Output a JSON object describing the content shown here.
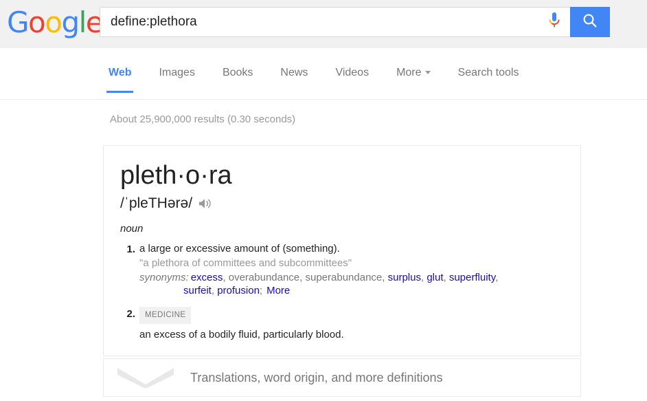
{
  "header": {
    "logo": {
      "letters": [
        {
          "char": "G",
          "color": "#4285f4"
        },
        {
          "char": "o",
          "color": "#ea4335"
        },
        {
          "char": "o",
          "color": "#fbbc05"
        },
        {
          "char": "g",
          "color": "#4285f4"
        },
        {
          "char": "l",
          "color": "#34a853"
        },
        {
          "char": "e",
          "color": "#ea4335"
        }
      ],
      "alt": "Google"
    },
    "search": {
      "value": "define:plethora",
      "placeholder": "Search",
      "mic_icon": "microphone-icon",
      "search_icon": "search-icon",
      "button_color": "#4285f4"
    }
  },
  "nav": {
    "tabs": [
      {
        "label": "Web",
        "active": true
      },
      {
        "label": "Images",
        "active": false
      },
      {
        "label": "Books",
        "active": false
      },
      {
        "label": "News",
        "active": false
      },
      {
        "label": "Videos",
        "active": false
      },
      {
        "label": "More",
        "active": false,
        "has_caret": true
      },
      {
        "label": "Search tools",
        "active": false
      }
    ],
    "active_color": "#4285f4"
  },
  "results": {
    "stats": "About 25,900,000 results (0.30 seconds)"
  },
  "definition_card": {
    "headword": "pleth·o·ra",
    "pronunciation": "/ˈpleTHərə/",
    "speaker_icon": "speaker-icon",
    "part_of_speech": "noun",
    "senses": [
      {
        "number": "1.",
        "definition": "a large or excessive amount of (something).",
        "example": "\"a plethora of committees and subcommittees\"",
        "synonyms_label": "synonyms:",
        "synonyms_line1": [
          {
            "text": "excess",
            "link": true
          },
          {
            "text": ", ",
            "link": false
          },
          {
            "text": "overabundance",
            "link": false
          },
          {
            "text": ", ",
            "link": false
          },
          {
            "text": "superabundance",
            "link": false
          },
          {
            "text": ", ",
            "link": false
          },
          {
            "text": "surplus",
            "link": true
          },
          {
            "text": ", ",
            "link": false
          },
          {
            "text": "glut",
            "link": true
          },
          {
            "text": ", ",
            "link": false
          },
          {
            "text": "superfluity",
            "link": true
          },
          {
            "text": ",",
            "link": false
          }
        ],
        "synonyms_line2": [
          {
            "text": "surfeit",
            "link": true
          },
          {
            "text": ", ",
            "link": false
          },
          {
            "text": "profusion",
            "link": true
          },
          {
            "text": ";",
            "link": false
          }
        ],
        "more_label": "More"
      },
      {
        "number": "2.",
        "badge": "MEDICINE",
        "definition": "an excess of a bodily fluid, particularly blood."
      }
    ]
  },
  "expand_row": {
    "chevron_icon": "chevron-down-icon",
    "label": "Translations, word origin, and more definitions"
  }
}
